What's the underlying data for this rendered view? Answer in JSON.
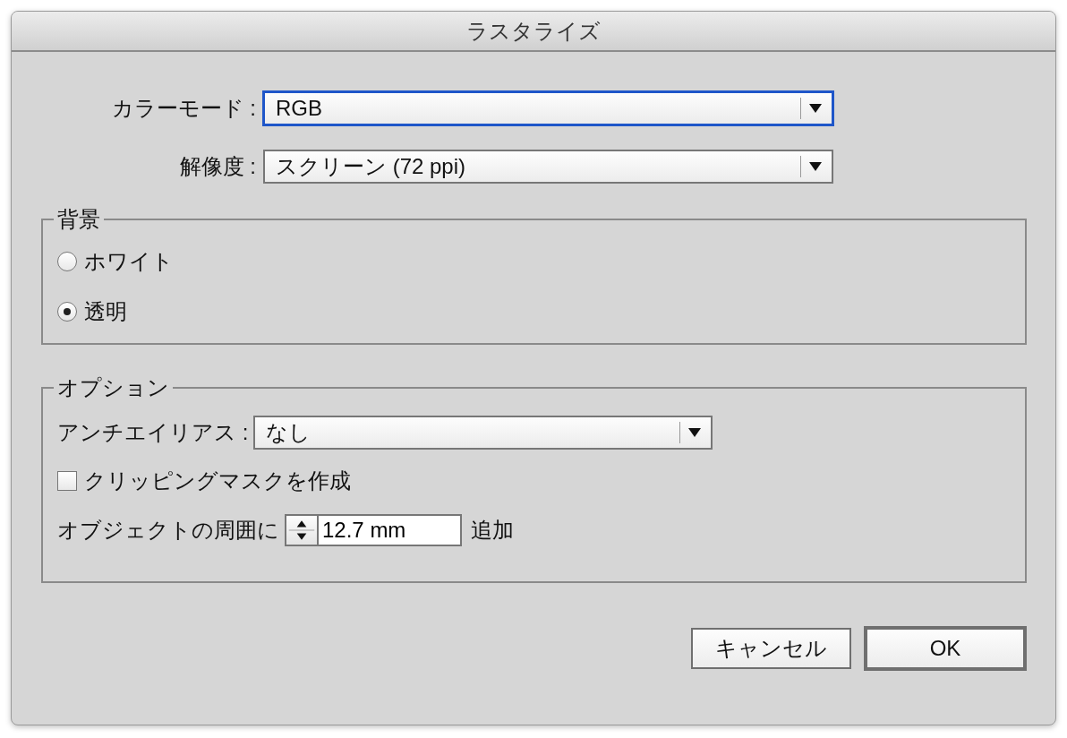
{
  "window": {
    "title": "ラスタライズ"
  },
  "color_mode": {
    "label": "カラーモード :",
    "value": "RGB",
    "focused": true
  },
  "resolution": {
    "label": "解像度 :",
    "value": "スクリーン (72 ppi)",
    "focused": false
  },
  "background": {
    "title": "背景",
    "options": [
      {
        "label": "ホワイト",
        "selected": false
      },
      {
        "label": "透明",
        "selected": true
      }
    ]
  },
  "options": {
    "title": "オプション",
    "antialias": {
      "label": "アンチエイリアス :",
      "value": "なし"
    },
    "clipping_mask": {
      "label": "クリッピングマスクを作成",
      "checked": false
    },
    "padding": {
      "label": "オブジェクトの周囲に",
      "value": "12.7 mm",
      "suffix": "追加"
    }
  },
  "buttons": [
    {
      "label": "キャンセル",
      "default": false
    },
    {
      "label": "OK",
      "default": true
    }
  ]
}
